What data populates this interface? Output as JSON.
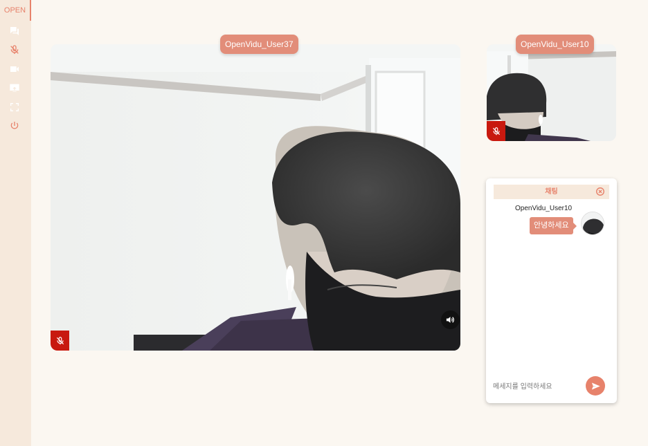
{
  "sidebar": {
    "logo": "OPEN",
    "icons": [
      "chat-icon",
      "mic-off-icon",
      "videocam-icon",
      "screen-share-icon",
      "fullscreen-icon",
      "power-icon"
    ]
  },
  "main_video": {
    "user": "OpenVidu_User37",
    "muted": true
  },
  "small_video": {
    "user": "OpenVidu_User10",
    "muted": true
  },
  "chat": {
    "title": "채팅",
    "messages": [
      {
        "user": "OpenVidu_User10",
        "text": "안녕하세요"
      }
    ],
    "input_placeholder": "메세지를 입력하세요"
  },
  "colors": {
    "accent": "#e7826b",
    "tag": "#e28d79",
    "sidebar_bg": "#f6e9dc",
    "page_bg": "#fbf7f1",
    "mute_red": "#c8190f"
  }
}
